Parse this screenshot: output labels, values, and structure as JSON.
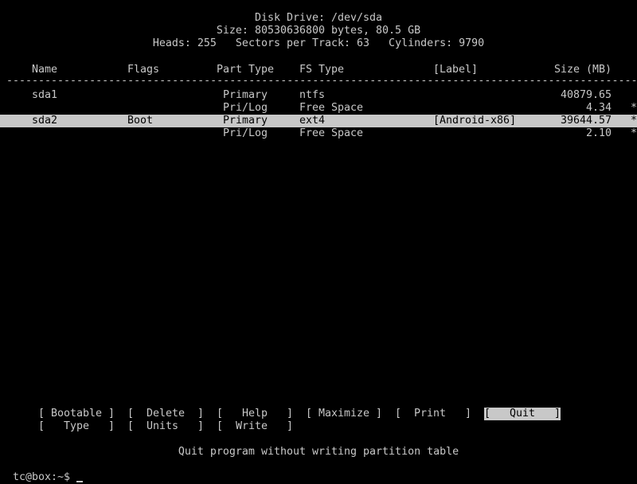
{
  "header": {
    "disk": "Disk Drive: /dev/sda",
    "size": "Size: 80530636800 bytes, 80.5 GB",
    "geometry": "Heads: 255   Sectors per Track: 63   Cylinders: 9790"
  },
  "columns": {
    "name": "Name",
    "flags": "Flags",
    "part_type": "Part Type",
    "fs_type": "FS Type",
    "label": "[Label]",
    "size": "Size (MB)"
  },
  "separator": "-----------------------------------------------------------------------------------------------------------------",
  "partitions": [
    {
      "name": "sda1",
      "flags": "",
      "part_type": "Primary",
      "fs_type": "ntfs",
      "label": "",
      "size": "40879.65",
      "marker": ""
    },
    {
      "name": "",
      "flags": "",
      "part_type": "Pri/Log",
      "fs_type": "Free Space",
      "label": "",
      "size": "4.34",
      "marker": "*"
    },
    {
      "name": "sda2",
      "flags": "Boot",
      "part_type": "Primary",
      "fs_type": "ext4",
      "label": "[Android-x86]",
      "size": "39644.57",
      "marker": "*"
    },
    {
      "name": "",
      "flags": "",
      "part_type": "Pri/Log",
      "fs_type": "Free Space",
      "label": "",
      "size": "2.10",
      "marker": "*"
    }
  ],
  "menu": {
    "bootable": "[ Bootable ]",
    "delete": "[  Delete  ]",
    "help": "[   Help   ]",
    "maximize": "[ Maximize ]",
    "print": "[  Print   ]",
    "quit": "[   Quit   ]",
    "type": "[   Type   ]",
    "units": "[  Units   ]",
    "write": "[  Write   ]"
  },
  "status": "Quit program without writing partition table",
  "prompt": "tc@box:~$"
}
